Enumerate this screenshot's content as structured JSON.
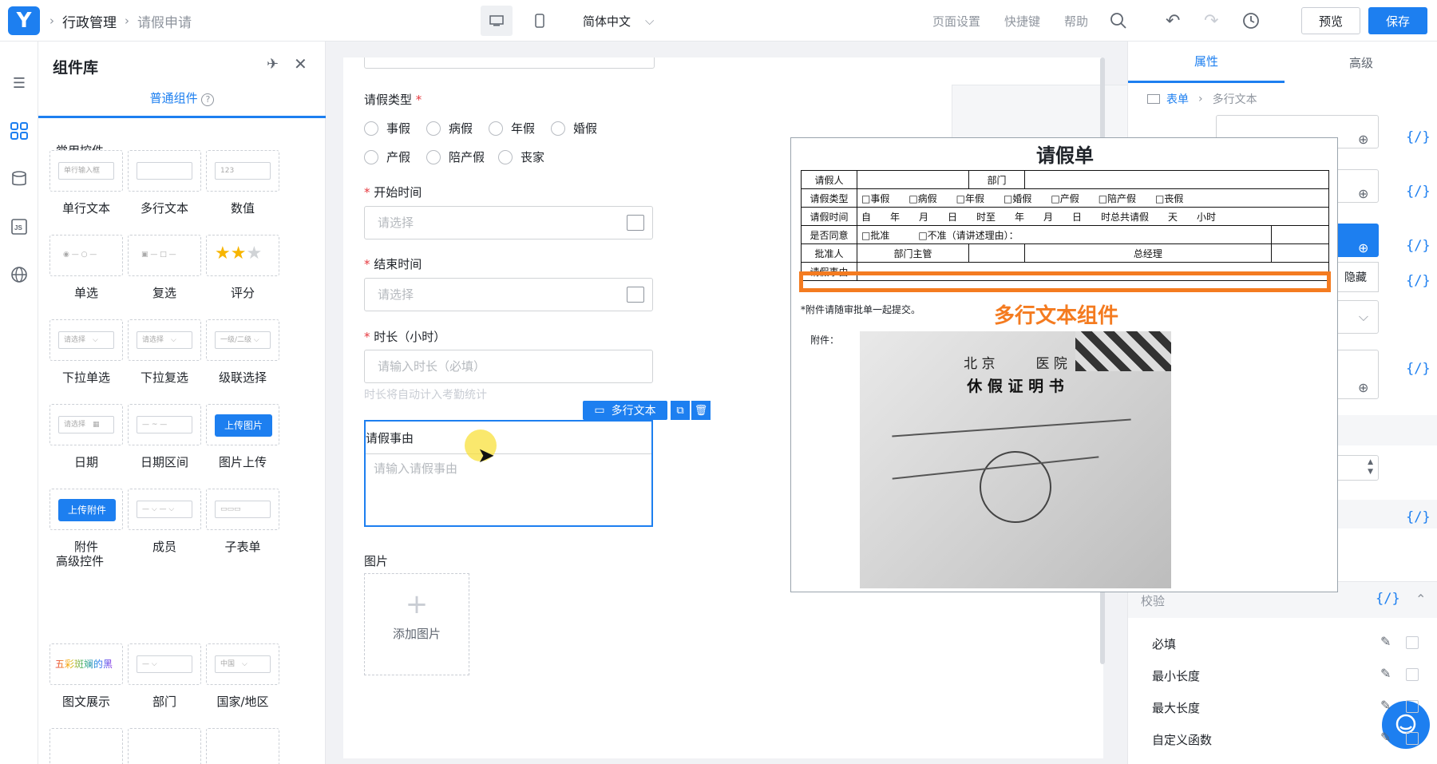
{
  "topbar": {
    "breadcrumb": [
      "行政管理",
      "请假申请"
    ],
    "language": "简体中文",
    "links": [
      "页面设置",
      "快捷键",
      "帮助"
    ],
    "preview_label": "预览",
    "save_label": "保存"
  },
  "component_library": {
    "title": "组件库",
    "tab": "普通组件",
    "common_section": "常用控件",
    "common_items": [
      "单行文本",
      "多行文本",
      "数值",
      "单选",
      "复选",
      "评分",
      "下拉单选",
      "下拉复选",
      "级联选择",
      "日期",
      "日期区间",
      "图片上传",
      "附件",
      "成员",
      "子表单"
    ],
    "advanced_section": "高级控件",
    "advanced_items": [
      "图文展示",
      "部门",
      "国家/地区"
    ],
    "preview_texts": {
      "single_line": "单行输入框",
      "number": "123",
      "select": "请选择",
      "cascade": "一级/二级",
      "upload_image": "上传图片",
      "upload_file": "上传附件",
      "rich": "五彩斑斓的黑",
      "country": "中国"
    }
  },
  "form": {
    "leave_type_label": "请假类型",
    "leave_types": [
      "事假",
      "病假",
      "年假",
      "婚假",
      "产假",
      "陪产假",
      "丧家"
    ],
    "start_label": "开始时间",
    "start_placeholder": "请选择",
    "end_label": "结束时间",
    "end_placeholder": "请选择",
    "duration_label": "时长（小时）",
    "duration_placeholder": "请输入时长（必填）",
    "duration_hint": "时长将自动计入考勤统计",
    "selected_tag": "多行文本",
    "reason_label": "请假事由",
    "reason_placeholder": "请输入请假事由",
    "image_label": "图片",
    "add_image": "添加图片"
  },
  "properties": {
    "tabs": [
      "属性",
      "高级"
    ],
    "breadcrumb": [
      "表单",
      "多行文本"
    ],
    "hide_label": "隐藏",
    "validation_label": "校验",
    "validation_items": [
      "必填",
      "最小长度",
      "最大长度",
      "自定义函数"
    ]
  },
  "overlay": {
    "doc_title": "请假单",
    "table_rows": [
      [
        "请假人",
        "",
        "部门",
        ""
      ],
      [
        "请假类型",
        "□事假　　□病假　　□年假　　□婚假　　□产假　　□陪产假　　□丧假"
      ],
      [
        "请假时间",
        "自　　年　　月　　日　　时至　　年　　月　　日　　时总共请假　　天　　小时"
      ],
      [
        "是否同意",
        "□批准　　　□不准（请讲述理由）：",
        ""
      ],
      [
        "批准人",
        "部门主管",
        "",
        "总经理",
        ""
      ],
      [
        "请假事由",
        ""
      ]
    ],
    "note": "*附件请随审批单一起提交。",
    "attachment_label": "附件：",
    "callout": "多行文本组件",
    "cert_title": "北 京　　　医 院",
    "cert_subtitle": "休 假 证 明 书"
  },
  "colors": {
    "accent": "#1d7ff0",
    "highlight": "#f47b20"
  }
}
